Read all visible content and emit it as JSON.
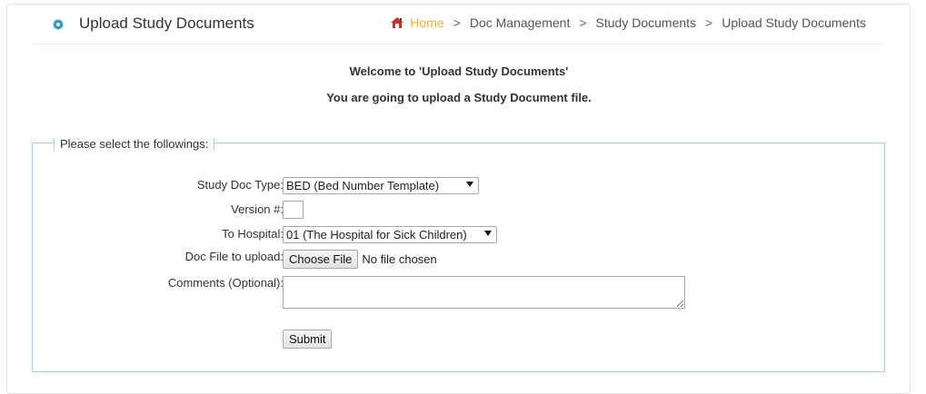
{
  "header": {
    "title": "Upload Study Documents",
    "breadcrumb": {
      "home": "Home",
      "separator": ">",
      "items": [
        "Doc Management",
        "Study Documents",
        "Upload Study Documents"
      ]
    }
  },
  "welcome": {
    "line1": "Welcome to 'Upload Study Documents'",
    "line2": "You are going to upload a Study Document file."
  },
  "form": {
    "legend": "Please select the followings:",
    "doc_type": {
      "label": "Study Doc Type:",
      "selected": "BED (Bed Number Template)"
    },
    "version": {
      "label": "Version #:",
      "value": ""
    },
    "hospital": {
      "label": "To Hospital:",
      "selected": "01 (The Hospital for Sick Children)"
    },
    "doc_file": {
      "label": "Doc File to upload:",
      "button": "Choose File",
      "status": "No file chosen"
    },
    "comments": {
      "label": "Comments (Optional):",
      "value": ""
    },
    "submit_label": "Submit"
  },
  "colors": {
    "accent_home": "#f0ad2f",
    "header_dot": "#2f97c7",
    "fieldset_border": "#9fd0de"
  }
}
